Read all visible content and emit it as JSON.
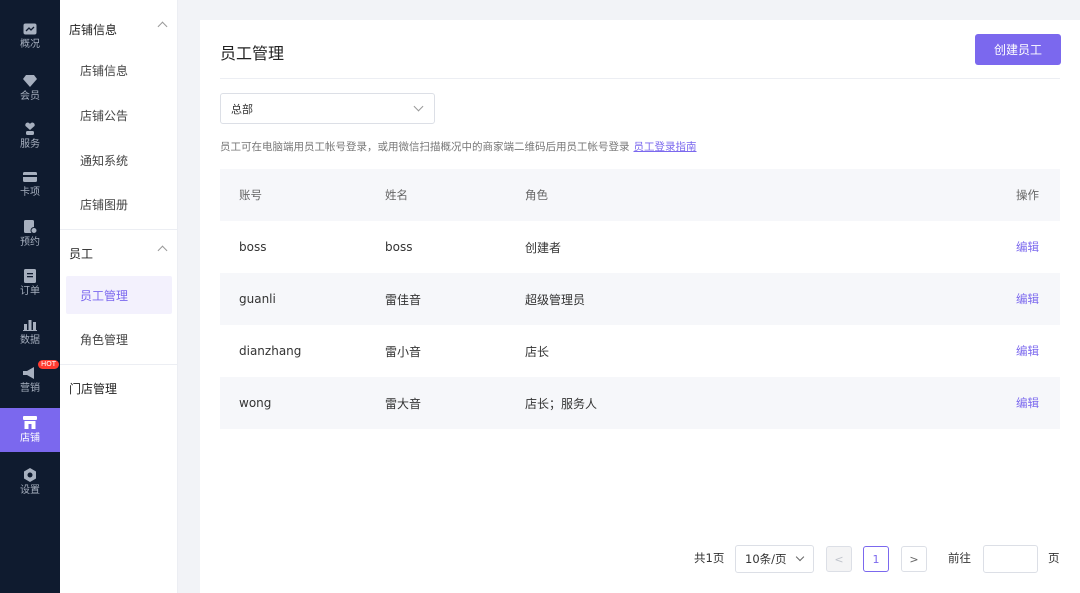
{
  "rail": {
    "items": [
      {
        "label": "概况",
        "icon": "chart-icon"
      },
      {
        "label": "会员",
        "icon": "diamond-icon"
      },
      {
        "label": "服务",
        "icon": "heart-hand-icon"
      },
      {
        "label": "卡项",
        "icon": "card-icon"
      },
      {
        "label": "预约",
        "icon": "calendar-icon"
      },
      {
        "label": "订单",
        "icon": "order-icon"
      },
      {
        "label": "数据",
        "icon": "bar-chart-icon"
      },
      {
        "label": "营销",
        "icon": "megaphone-icon",
        "badge": "HOT"
      },
      {
        "label": "店铺",
        "icon": "store-icon",
        "active": true
      },
      {
        "label": "设置",
        "icon": "gear-icon"
      }
    ]
  },
  "submenu": {
    "group1": "店铺信息",
    "group1_items": [
      "店铺信息",
      "店铺公告",
      "通知系统",
      "店铺图册"
    ],
    "group2": "员工",
    "group2_items": [
      "员工管理",
      "角色管理"
    ],
    "group3": "门店管理"
  },
  "main": {
    "title": "员工管理",
    "create_button": "创建员工",
    "select_value": "总部",
    "tip_text": "员工可在电脑端用员工帐号登录，或用微信扫描概况中的商家端二维码后用员工帐号登录",
    "tip_link": "员工登录指南",
    "table": {
      "headers": [
        "账号",
        "姓名",
        "角色",
        "操作"
      ],
      "rows": [
        {
          "account": "boss",
          "name": "boss",
          "role": "创建者",
          "action": "编辑"
        },
        {
          "account": "guanli",
          "name": "雷佳音",
          "role": "超级管理员",
          "action": "编辑"
        },
        {
          "account": "dianzhang",
          "name": "雷小音",
          "role": "店长",
          "action": "编辑"
        },
        {
          "account": "wong",
          "name": "雷大音",
          "role": "店长；服务人",
          "action": "编辑"
        }
      ]
    }
  },
  "pagination": {
    "total": "共1页",
    "page_size": "10条/页",
    "prev": "<",
    "current_page": "1",
    "next": ">",
    "goto_label": "前往",
    "goto_value": "",
    "page_suffix": "页"
  },
  "colors": {
    "accent": "#7b68ee",
    "rail_bg": "#0f1b2f",
    "hot": "#ff3b30"
  }
}
